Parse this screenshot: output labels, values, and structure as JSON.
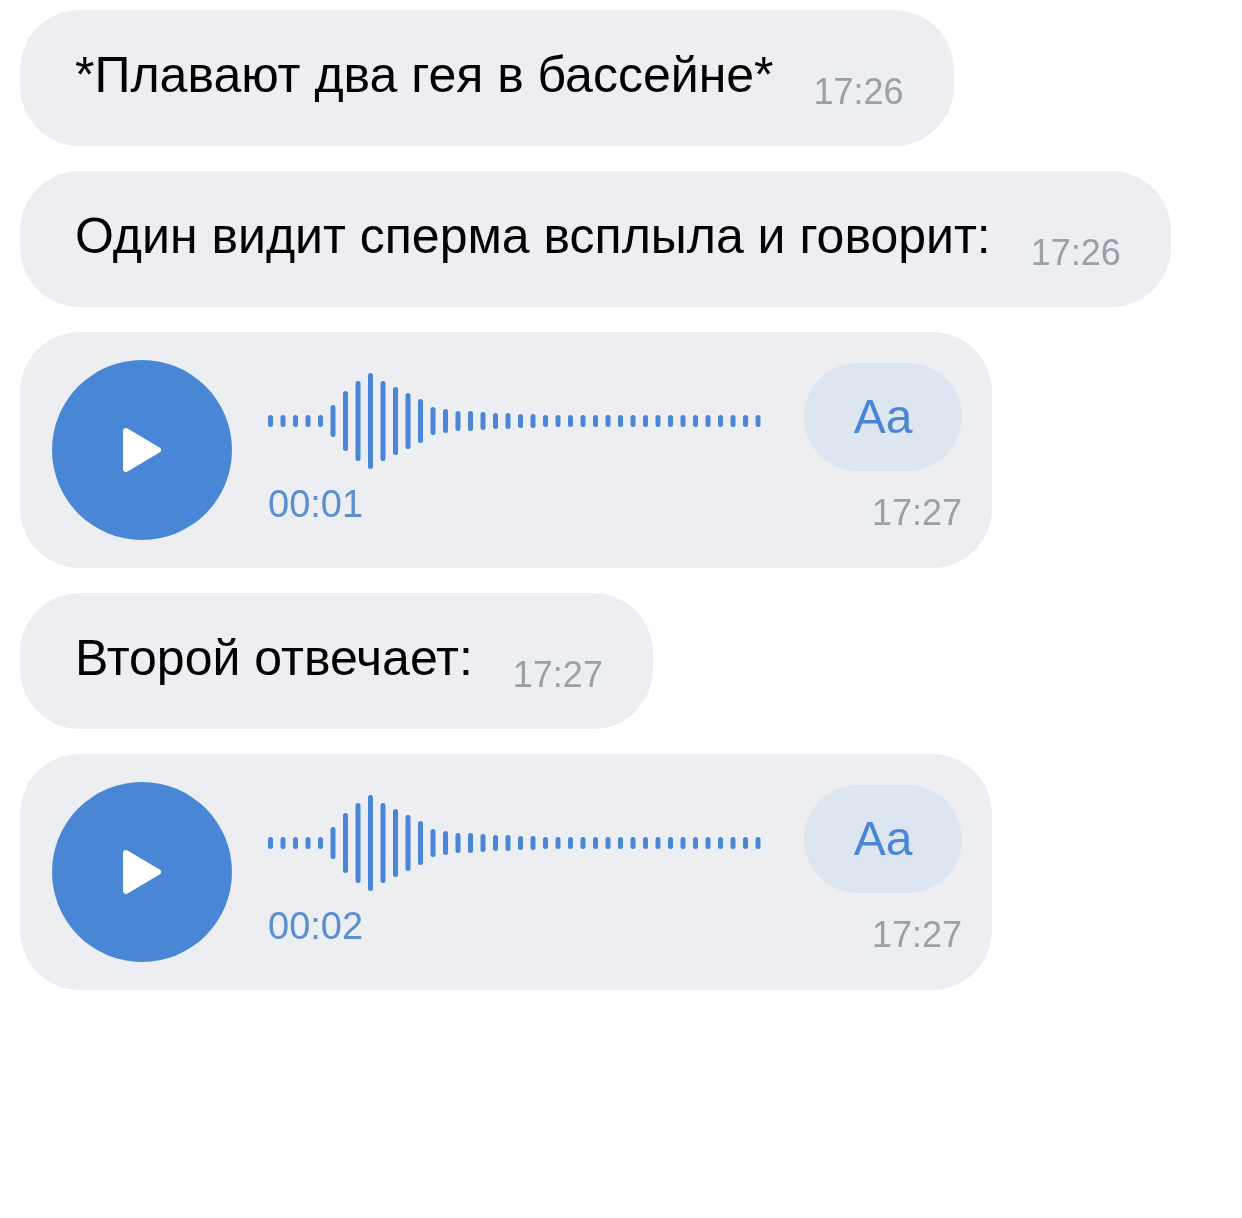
{
  "messages": [
    {
      "kind": "text",
      "text": "*Плавают два гея в бассейне*",
      "time": "17:26"
    },
    {
      "kind": "text",
      "text": "Один видит сперма всплыла и говорит:",
      "time": "17:26"
    },
    {
      "kind": "voice",
      "duration": "00:01",
      "transcribe": "Aa",
      "time": "17:27"
    },
    {
      "kind": "text",
      "text": "Второй отвечает:",
      "time": "17:27"
    },
    {
      "kind": "voice",
      "duration": "00:02",
      "transcribe": "Aa",
      "time": "17:27"
    }
  ]
}
